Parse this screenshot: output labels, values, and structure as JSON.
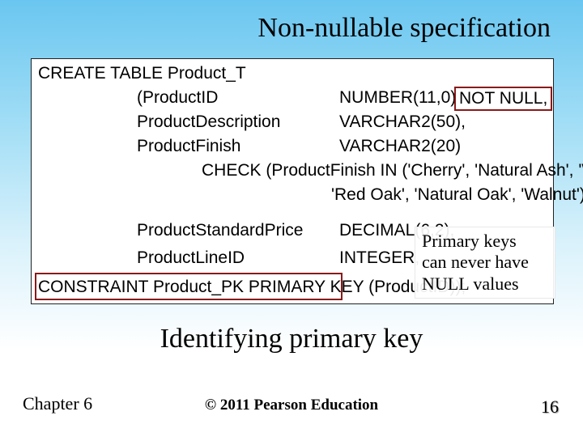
{
  "headings": {
    "top": "Non-nullable specification",
    "bottom": "Identifying primary key"
  },
  "sql": {
    "create": "CREATE TABLE Product_T",
    "col1_name": "(ProductID",
    "col1_type": "NUMBER(11,0)",
    "col1_constraint": "NOT NULL,",
    "col2_name": "ProductDescription",
    "col2_type": "VARCHAR2(50),",
    "col3_name": "ProductFinish",
    "col3_type": "VARCHAR2(20)",
    "check_line1": "CHECK (ProductFinish IN ('Cherry', 'Natural Ash', 'White Ash',",
    "check_line2": "'Red Oak', 'Natural Oak', 'Walnut')),",
    "col4_name": "ProductStandardPrice",
    "col4_type": "DECIMAL(6,2),",
    "col5_name": "ProductLineID",
    "col5_type": "INTEGER,",
    "constraint": "CONSTRAINT Product_PK PRIMARY KEY (ProductID));"
  },
  "annotation": {
    "line1": "Primary keys",
    "line2": "can never have",
    "line3": "NULL values"
  },
  "footer": {
    "chapter": "Chapter 6",
    "copyright": "© 2011 Pearson Education",
    "page": "16"
  }
}
